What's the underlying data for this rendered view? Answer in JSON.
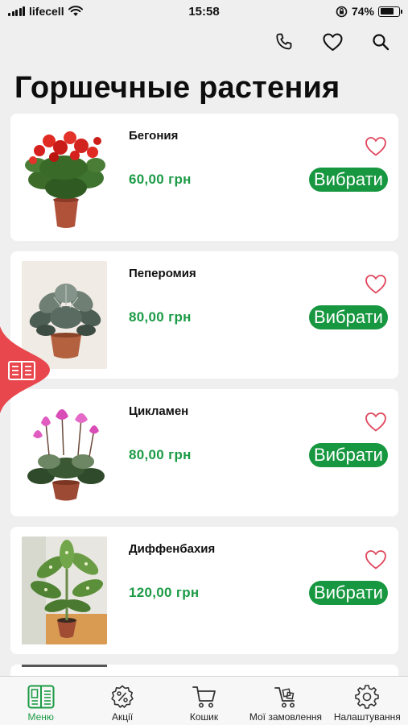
{
  "status_bar": {
    "carrier": "lifecell",
    "time": "15:58",
    "battery_percent": "74%",
    "battery_level": 0.74
  },
  "toolbar": {
    "icons": [
      "phone-icon",
      "heart-icon",
      "search-icon"
    ]
  },
  "page": {
    "title": "Горшечные растения"
  },
  "products": [
    {
      "name": "Бегония",
      "price": "60,00 грн",
      "button": "Вибрати"
    },
    {
      "name": "Пеперомия",
      "price": "80,00 грн",
      "button": "Вибрати"
    },
    {
      "name": "Цикламен",
      "price": "80,00 грн",
      "button": "Вибрати"
    },
    {
      "name": "Диффенбахия",
      "price": "120,00 грн",
      "button": "Вибрати"
    }
  ],
  "bottom_nav": {
    "items": [
      {
        "label": "Меню",
        "icon": "menu-book-icon",
        "active": true
      },
      {
        "label": "Акції",
        "icon": "discount-icon",
        "active": false
      },
      {
        "label": "Кошик",
        "icon": "cart-icon",
        "active": false
      },
      {
        "label": "Мої замовлення",
        "icon": "orders-cart-icon",
        "active": false
      },
      {
        "label": "Налаштування",
        "icon": "gear-icon",
        "active": false
      }
    ]
  },
  "colors": {
    "accent_green": "#1c9b46",
    "button_green": "#179740",
    "favorite_pink": "#e0485e",
    "catalog_tab_red": "#e8474d",
    "background": "#efefef"
  }
}
